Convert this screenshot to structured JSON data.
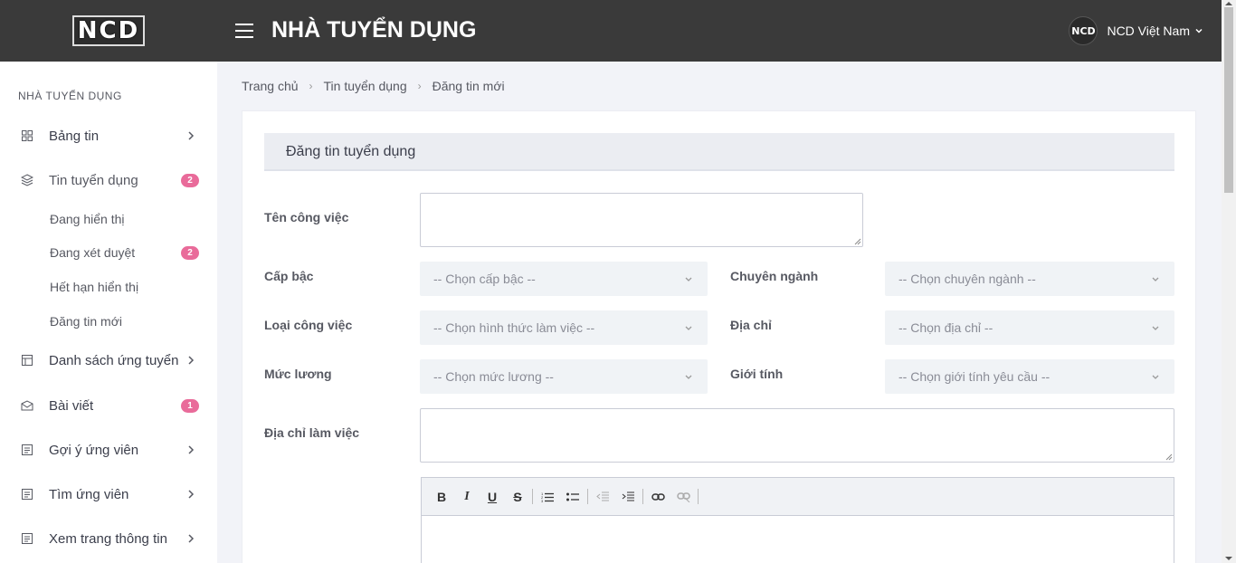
{
  "logo": "NCD",
  "header": {
    "title": "NHÀ TUYỂN DỤNG",
    "user_name": "NCD Việt Nam",
    "avatar_text": "NCD"
  },
  "sidebar": {
    "section_title": "NHÀ TUYỂN DỤNG",
    "items": [
      {
        "label": "Bảng tin",
        "icon": "dashboard-icon"
      },
      {
        "label": "Tin tuyển dụng",
        "icon": "layers-icon",
        "badge": "2"
      },
      {
        "label": "Danh sách ứng tuyển",
        "icon": "calendar-icon"
      },
      {
        "label": "Bài viết",
        "icon": "envelope-icon",
        "badge": "1"
      },
      {
        "label": "Gợi ý ứng viên",
        "icon": "document-icon"
      },
      {
        "label": "Tìm ứng viên",
        "icon": "document-icon"
      },
      {
        "label": "Xem trang thông tin",
        "icon": "document-icon"
      }
    ],
    "sub_items": [
      {
        "label": "Đang hiển thị"
      },
      {
        "label": "Đang xét duyệt",
        "badge": "2"
      },
      {
        "label": "Hết hạn hiển thị"
      },
      {
        "label": "Đăng tin mới"
      }
    ]
  },
  "breadcrumb": [
    "Trang chủ",
    "Tin tuyển dụng",
    "Đăng tin mới"
  ],
  "form": {
    "card_title": "Đăng tin tuyển dụng",
    "job_title_label": "Tên công việc",
    "level_label": "Cấp bậc",
    "level_placeholder": "-- Chọn cấp bậc --",
    "major_label": "Chuyên ngành",
    "major_placeholder": "-- Chọn chuyên ngành --",
    "job_type_label": "Loại công việc",
    "job_type_placeholder": "-- Chọn hình thức làm việc --",
    "address_label": "Địa chỉ",
    "address_placeholder": "-- Chọn địa chỉ --",
    "salary_label": "Mức lương",
    "salary_placeholder": "-- Chọn mức lương --",
    "gender_label": "Giới tính",
    "gender_placeholder": "-- Chọn giới tính yêu cầu --",
    "work_address_label": "Địa chỉ làm việc"
  },
  "editor_tools": [
    "bold-icon",
    "italic-icon",
    "underline-icon",
    "strikethrough-icon",
    "ordered-list-icon",
    "unordered-list-icon",
    "outdent-icon",
    "indent-icon",
    "link-icon",
    "unlink-icon"
  ],
  "colors": {
    "topbar": "#3a3a3a",
    "badge": "#e96b9a",
    "page_bg": "#f2f3f8"
  }
}
